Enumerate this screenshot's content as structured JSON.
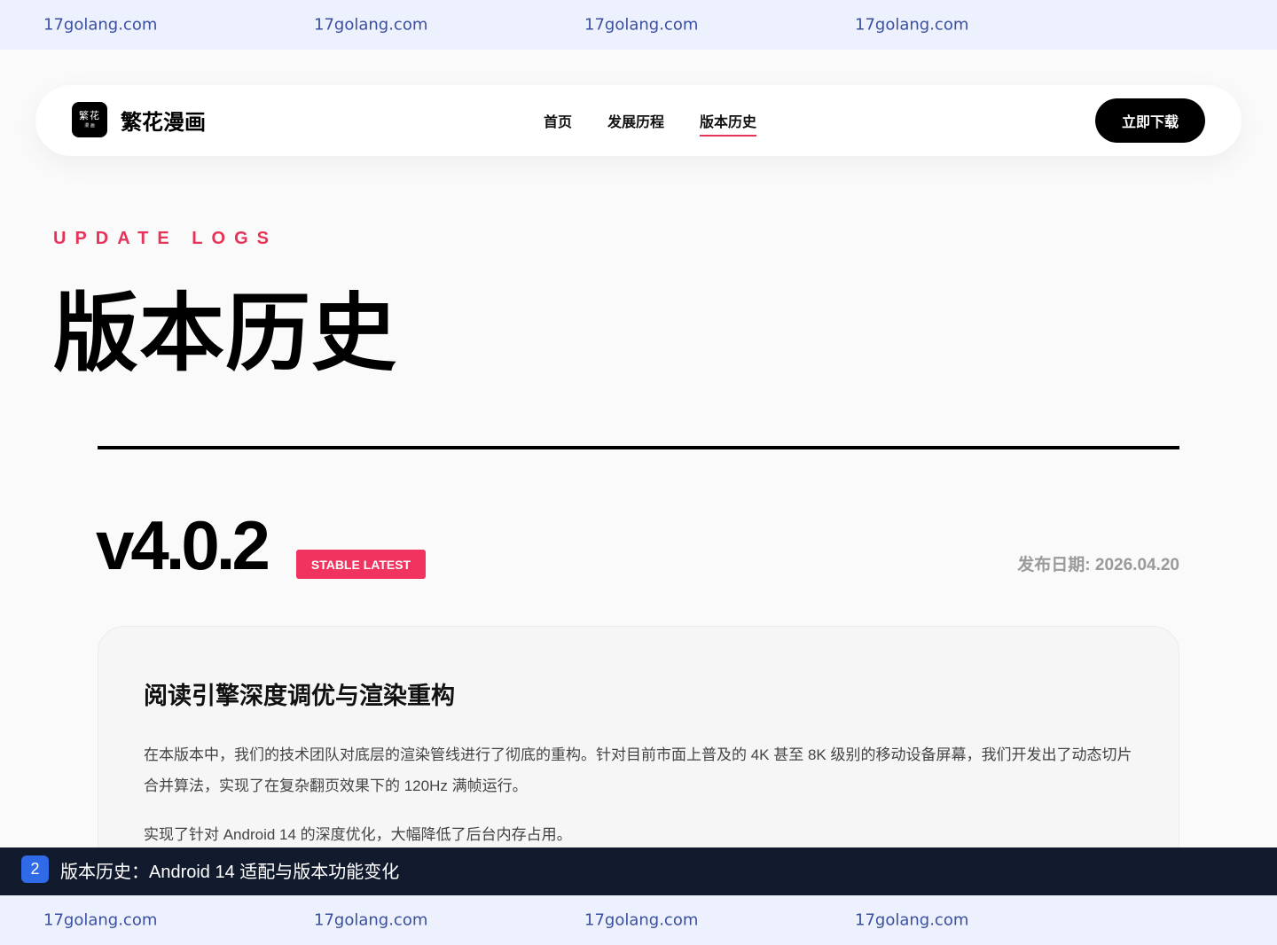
{
  "watermark": {
    "text": "17golang.com",
    "color": "#3b4fa0",
    "background": "#ecf1fd"
  },
  "header": {
    "logo_line1": "繁花",
    "logo_line2": "漫 画",
    "brand": "繁花漫画",
    "nav": [
      {
        "label": "首页",
        "active": false
      },
      {
        "label": "发展历程",
        "active": false
      },
      {
        "label": "版本历史",
        "active": true
      }
    ],
    "download_label": "立即下载"
  },
  "hero": {
    "kicker": "UPDATE LOGS",
    "title": "版本历史"
  },
  "release": {
    "version": "v4.0.2",
    "badge": "STABLE LATEST",
    "date": "发布日期: 2026.04.20",
    "card": {
      "title": "阅读引擎深度调优与渲染重构",
      "paragraphs": [
        "在本版本中，我们的技术团队对底层的渲染管线进行了彻底的重构。针对目前市面上普及的 4K 甚至 8K 级别的移动设备屏幕，我们开发出了动态切片合并算法，实现了在复杂翻页效果下的 120Hz 满帧运行。",
        "实现了针对 Android 14 的深度优化，大幅降低了后台内存占用。"
      ]
    }
  },
  "task_bar": {
    "number": "2",
    "text": "版本历史：Android 14 适配与版本功能变化"
  },
  "colors": {
    "accent": "#e6335a",
    "badge": "#f0335f",
    "task_bar": "#121b2e",
    "task_number": "#2f6be6"
  }
}
